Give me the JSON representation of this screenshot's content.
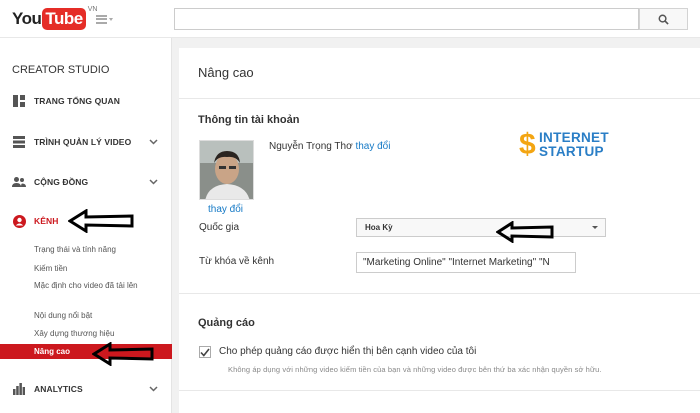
{
  "header": {
    "logo_you": "You",
    "logo_tube": "Tube",
    "logo_region": "VN",
    "search_placeholder": "",
    "search_icon": "search-icon"
  },
  "sidebar": {
    "title": "CREATOR STUDIO",
    "items": [
      {
        "label": "TRANG TỔNG QUAN",
        "icon": "dashboard-icon"
      },
      {
        "label": "TRÌNH QUẢN LÝ VIDEO",
        "icon": "video-manager-icon"
      },
      {
        "label": "CỘNG ĐỒNG",
        "icon": "community-icon"
      },
      {
        "label": "KÊNH",
        "icon": "channel-icon"
      },
      {
        "label": "ANALYTICS",
        "icon": "analytics-icon"
      }
    ],
    "channel_sub": [
      "Trạng thái và tính năng",
      "Kiếm tiền",
      "Mặc định cho video đã tải lên",
      "Nội dung nổi bật",
      "Xây dựng thương hiệu",
      "Nâng cao"
    ],
    "accent_color": "#cc181e"
  },
  "main": {
    "page_title": "Nâng cao",
    "account_section": "Thông tin tài khoản",
    "owner_name": "Nguyễn Trọng Thơ",
    "change_link": "thay đổi",
    "avatar_change_link": "thay đổi",
    "brand_line1": "INTERNET",
    "brand_line2": "STARTUP",
    "country_label": "Quốc gia",
    "country_value": "Hoa Kỳ",
    "keywords_label": "Từ khóa về kênh",
    "keywords_value": "\"Marketing Online\" \"Internet Marketing\" \"N",
    "ads_section": "Quảng cáo",
    "ads_checkbox_label": "Cho phép quảng cáo được hiển thị bên cạnh video của tôi",
    "ads_checked": true,
    "ads_note": "Không áp dụng với những video kiếm tiền của bạn và những video được bên thứ ba xác nhận quyền sở hữu."
  }
}
